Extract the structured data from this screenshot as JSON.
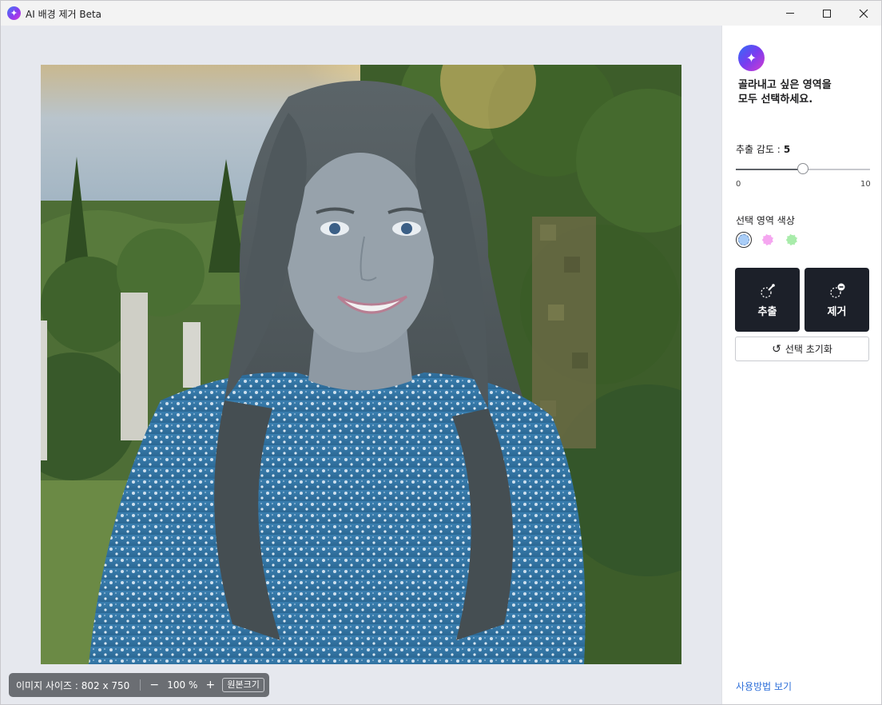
{
  "window": {
    "title": "AI 배경 제거 Beta",
    "app_icon": "sparkle-icon",
    "controls": {
      "minimize": "minimize-icon",
      "maximize": "maximize-icon",
      "close": "close-icon"
    }
  },
  "status": {
    "image_size": "이미지 사이즈 : 802 x 750",
    "zoom_out": "−",
    "zoom_value": "100 %",
    "zoom_in": "+",
    "original_size": "원본크기"
  },
  "panel": {
    "instruction_line1": "골라내고 싶은 영역을",
    "instruction_line2": "모두 선택하세요.",
    "sensitivity_label": "추출 감도 :",
    "sensitivity_value": "5",
    "slider": {
      "min": "0",
      "max": "10",
      "value": 5
    },
    "color_label": "선택 영역 색상",
    "colors": [
      "#a9cdf7",
      "#f5a6f0",
      "#a8ecaa"
    ],
    "selected_color_index": 0,
    "extract_label": "추출",
    "remove_label": "제거",
    "reset_label": "선택 초기화",
    "help_link": "사용방법 보기"
  },
  "photo": {
    "description_icon": "portrait-image",
    "colors": {
      "sky": "#b7c6cf",
      "forest": "#3f5e2c",
      "hair": "#4a5357",
      "skin": "#8f9aa4",
      "shirt": "#2f6f9c"
    }
  }
}
